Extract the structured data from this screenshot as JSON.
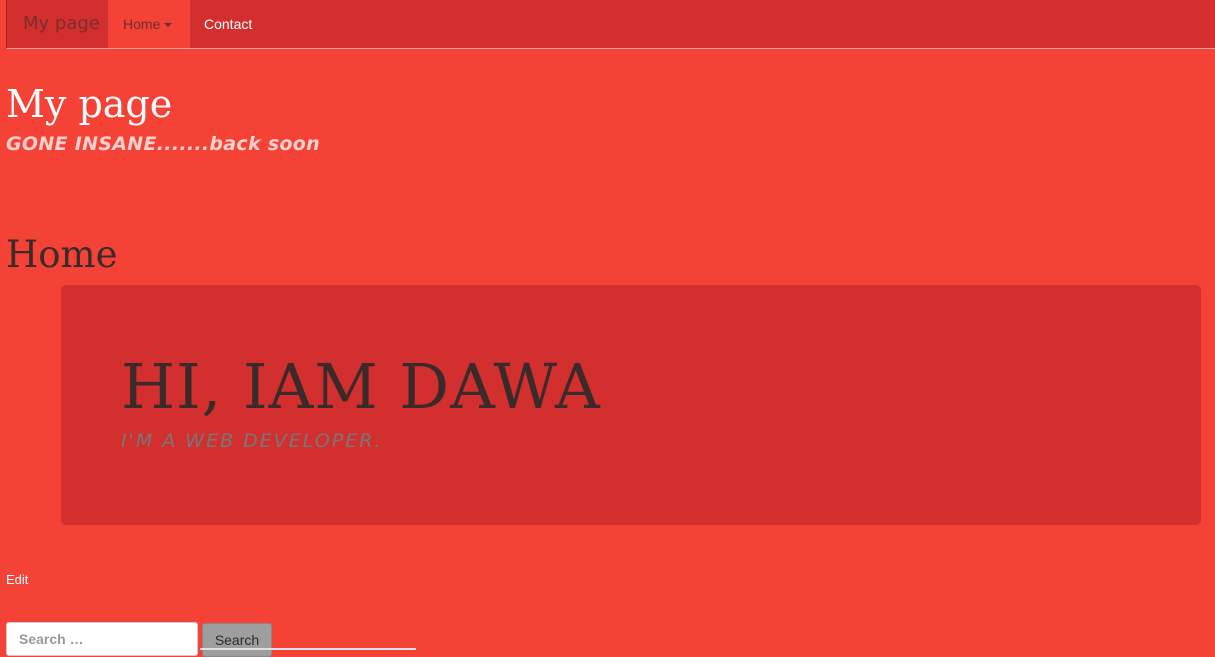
{
  "navbar": {
    "brand": "My page",
    "items": [
      {
        "label": "Home",
        "active": true,
        "has_dropdown": true
      },
      {
        "label": "Contact",
        "active": false,
        "has_dropdown": false
      }
    ]
  },
  "site": {
    "title": "My page",
    "tagline": "GONE INSANE.......back soon"
  },
  "main": {
    "heading": "Home",
    "jumbotron": {
      "title": "HI, IAM DAWA",
      "subtitle": "I'M A WEB DEVELOPER."
    },
    "edit_label": "Edit"
  },
  "search": {
    "placeholder": "Search …",
    "button_label": "Search"
  },
  "colors": {
    "background": "#f44336",
    "navbar": "#d32f2f",
    "active_tab": "#f44336",
    "jumbotron": "#d32f2f",
    "button": "#9e9e9e"
  }
}
